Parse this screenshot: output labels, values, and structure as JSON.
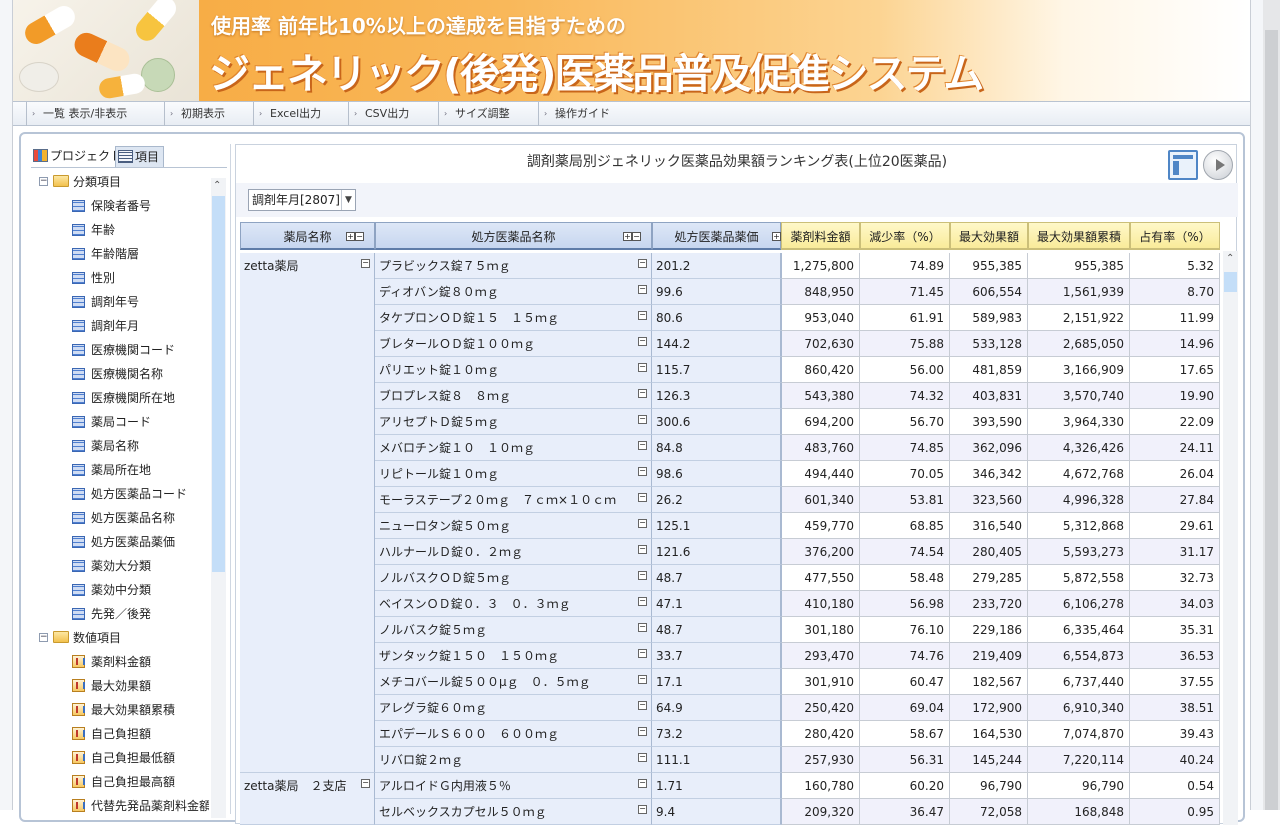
{
  "banner": {
    "subtitle": "使用率 前年比10%以上の達成を目指すための",
    "title": "ジェネリック(後発)医薬品普及促進システム"
  },
  "toolbar": [
    "一覧 表示/非表示",
    "初期表示",
    "Excel出力",
    "CSV出力",
    "サイズ調整",
    "操作ガイド"
  ],
  "left_tabs": {
    "project": "プロジェクト",
    "items": "項目"
  },
  "tree": {
    "group1": "分類項目",
    "group1_items": [
      "保険者番号",
      "年齢",
      "年齢階層",
      "性別",
      "調剤年号",
      "調剤年月",
      "医療機関コード",
      "医療機関名称",
      "医療機関所在地",
      "薬局コード",
      "薬局名称",
      "薬局所在地",
      "処方医薬品コード",
      "処方医薬品名称",
      "処方医薬品薬価",
      "薬効大分類",
      "薬効中分類",
      "先発／後発"
    ],
    "group2": "数値項目",
    "group2_items": [
      "薬剤料金額",
      "最大効果額",
      "最大効果額累積",
      "自己負担額",
      "自己負担最低額",
      "自己負担最高額",
      "代替先発品薬剤料金額"
    ]
  },
  "report": {
    "title": "調剤薬局別ジェネリック医薬品効果額ランキング表(上位20医薬品)",
    "filter": "調剤年月[2807]"
  },
  "headers": {
    "pharmacy": "薬局名称",
    "drug": "処方医薬品名称",
    "price": "処方医薬品薬価",
    "amount": "薬剤料金額",
    "reduction": "減少率（%）",
    "max_effect": "最大効果額",
    "cumulative": "最大効果額累積",
    "share": "占有率（%）"
  },
  "groups": [
    {
      "pharmacy": "zetta薬局",
      "row_count": 20
    },
    {
      "pharmacy": "zetta薬局　２支店",
      "row_count": 2
    }
  ],
  "rows": [
    {
      "drug": "プラビックス錠７５ｍｇ",
      "price": "201.2",
      "amount": "1,275,800",
      "reduction": "74.89",
      "max_effect": "955,385",
      "cumulative": "955,385",
      "share": "5.32"
    },
    {
      "drug": "ディオバン錠８０ｍｇ",
      "price": "99.6",
      "amount": "848,950",
      "reduction": "71.45",
      "max_effect": "606,554",
      "cumulative": "1,561,939",
      "share": "8.70"
    },
    {
      "drug": "タケプロンＯＤ錠１５　１５ｍｇ",
      "price": "80.6",
      "amount": "953,040",
      "reduction": "61.91",
      "max_effect": "589,983",
      "cumulative": "2,151,922",
      "share": "11.99"
    },
    {
      "drug": "ブレタールＯＤ錠１００ｍｇ",
      "price": "144.2",
      "amount": "702,630",
      "reduction": "75.88",
      "max_effect": "533,128",
      "cumulative": "2,685,050",
      "share": "14.96"
    },
    {
      "drug": "パリエット錠１０ｍｇ",
      "price": "115.7",
      "amount": "860,420",
      "reduction": "56.00",
      "max_effect": "481,859",
      "cumulative": "3,166,909",
      "share": "17.65"
    },
    {
      "drug": "ブロプレス錠８　８ｍｇ",
      "price": "126.3",
      "amount": "543,380",
      "reduction": "74.32",
      "max_effect": "403,831",
      "cumulative": "3,570,740",
      "share": "19.90"
    },
    {
      "drug": "アリセプトＤ錠５ｍｇ",
      "price": "300.6",
      "amount": "694,200",
      "reduction": "56.70",
      "max_effect": "393,590",
      "cumulative": "3,964,330",
      "share": "22.09"
    },
    {
      "drug": "メバロチン錠１０　１０ｍｇ",
      "price": "84.8",
      "amount": "483,760",
      "reduction": "74.85",
      "max_effect": "362,096",
      "cumulative": "4,326,426",
      "share": "24.11"
    },
    {
      "drug": "リピトール錠１０ｍｇ",
      "price": "98.6",
      "amount": "494,440",
      "reduction": "70.05",
      "max_effect": "346,342",
      "cumulative": "4,672,768",
      "share": "26.04"
    },
    {
      "drug": "モーラステープ２０ｍｇ　７ｃｍ×１０ｃｍ",
      "price": "26.2",
      "amount": "601,340",
      "reduction": "53.81",
      "max_effect": "323,560",
      "cumulative": "4,996,328",
      "share": "27.84"
    },
    {
      "drug": "ニューロタン錠５０ｍｇ",
      "price": "125.1",
      "amount": "459,770",
      "reduction": "68.85",
      "max_effect": "316,540",
      "cumulative": "5,312,868",
      "share": "29.61"
    },
    {
      "drug": "ハルナールＤ錠０．２ｍｇ",
      "price": "121.6",
      "amount": "376,200",
      "reduction": "74.54",
      "max_effect": "280,405",
      "cumulative": "5,593,273",
      "share": "31.17"
    },
    {
      "drug": "ノルバスクＯＤ錠５ｍｇ",
      "price": "48.7",
      "amount": "477,550",
      "reduction": "58.48",
      "max_effect": "279,285",
      "cumulative": "5,872,558",
      "share": "32.73"
    },
    {
      "drug": "ベイスンＯＤ錠０．３　０．３ｍｇ",
      "price": "47.1",
      "amount": "410,180",
      "reduction": "56.98",
      "max_effect": "233,720",
      "cumulative": "6,106,278",
      "share": "34.03"
    },
    {
      "drug": "ノルバスク錠５ｍｇ",
      "price": "48.7",
      "amount": "301,180",
      "reduction": "76.10",
      "max_effect": "229,186",
      "cumulative": "6,335,464",
      "share": "35.31"
    },
    {
      "drug": "ザンタック錠１５０　１５０ｍｇ",
      "price": "33.7",
      "amount": "293,470",
      "reduction": "74.76",
      "max_effect": "219,409",
      "cumulative": "6,554,873",
      "share": "36.53"
    },
    {
      "drug": "メチコバール錠５００μｇ　０．５ｍｇ",
      "price": "17.1",
      "amount": "301,910",
      "reduction": "60.47",
      "max_effect": "182,567",
      "cumulative": "6,737,440",
      "share": "37.55"
    },
    {
      "drug": "アレグラ錠６０ｍｇ",
      "price": "64.9",
      "amount": "250,420",
      "reduction": "69.04",
      "max_effect": "172,900",
      "cumulative": "6,910,340",
      "share": "38.51"
    },
    {
      "drug": "エパデールＳ６００　６００ｍｇ",
      "price": "73.2",
      "amount": "280,420",
      "reduction": "58.67",
      "max_effect": "164,530",
      "cumulative": "7,074,870",
      "share": "39.43"
    },
    {
      "drug": "リバロ錠２ｍｇ",
      "price": "111.1",
      "amount": "257,930",
      "reduction": "56.31",
      "max_effect": "145,244",
      "cumulative": "7,220,114",
      "share": "40.24"
    },
    {
      "drug": "アルロイドＧ内用液５％",
      "price": "1.71",
      "amount": "160,780",
      "reduction": "60.20",
      "max_effect": "96,790",
      "cumulative": "96,790",
      "share": "0.54"
    },
    {
      "drug": "セルベックスカプセル５０ｍｇ",
      "price": "9.4",
      "amount": "209,320",
      "reduction": "36.47",
      "max_effect": "72,058",
      "cumulative": "168,848",
      "share": "0.95"
    }
  ]
}
